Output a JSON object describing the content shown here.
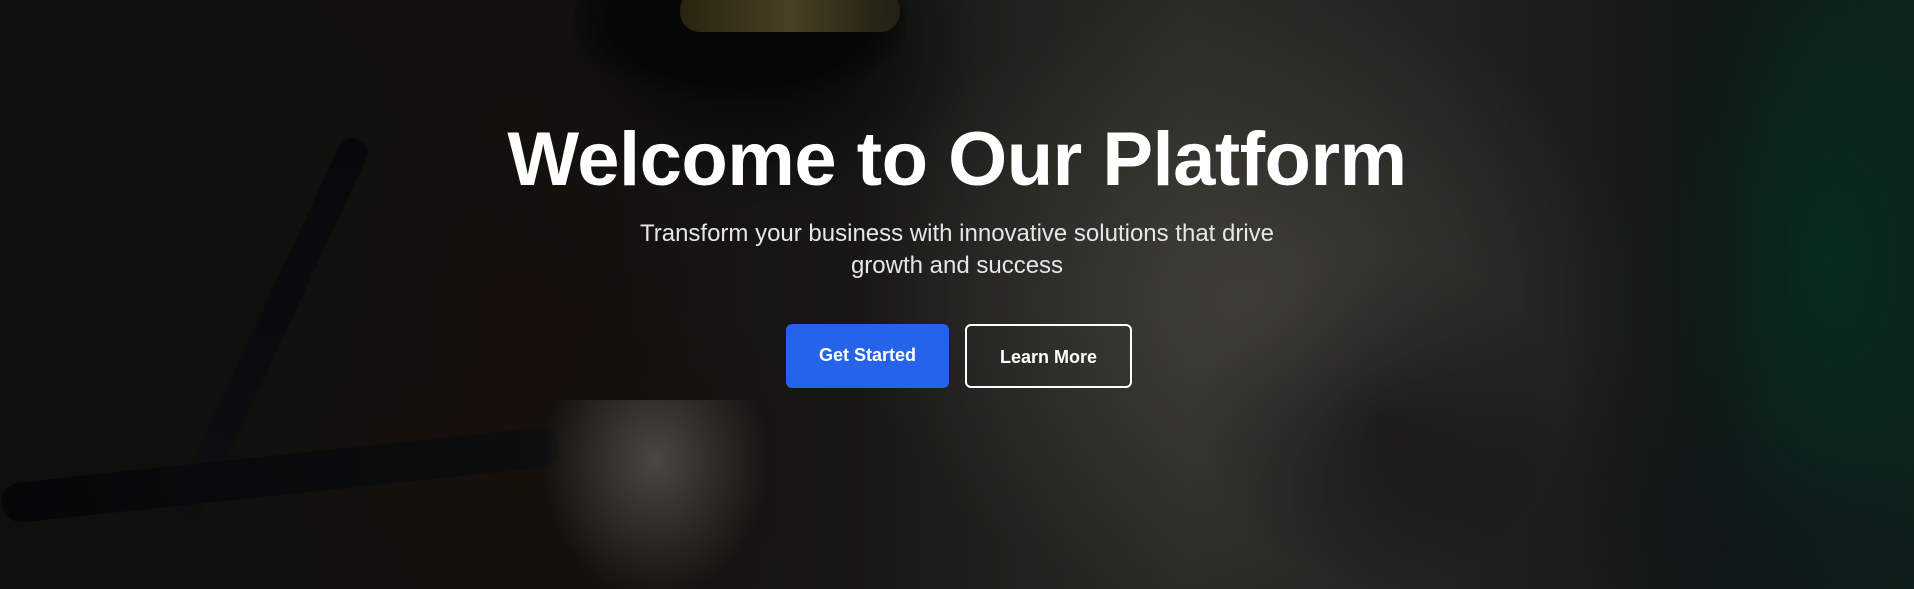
{
  "hero": {
    "title": "Welcome to Our Platform",
    "subtitle": "Transform your business with innovative solutions that drive growth and success",
    "primary_button_label": "Get Started",
    "secondary_button_label": "Learn More"
  },
  "colors": {
    "primary_button": "#2563eb",
    "text": "#ffffff",
    "overlay": "rgba(0,0,0,0.42)"
  }
}
